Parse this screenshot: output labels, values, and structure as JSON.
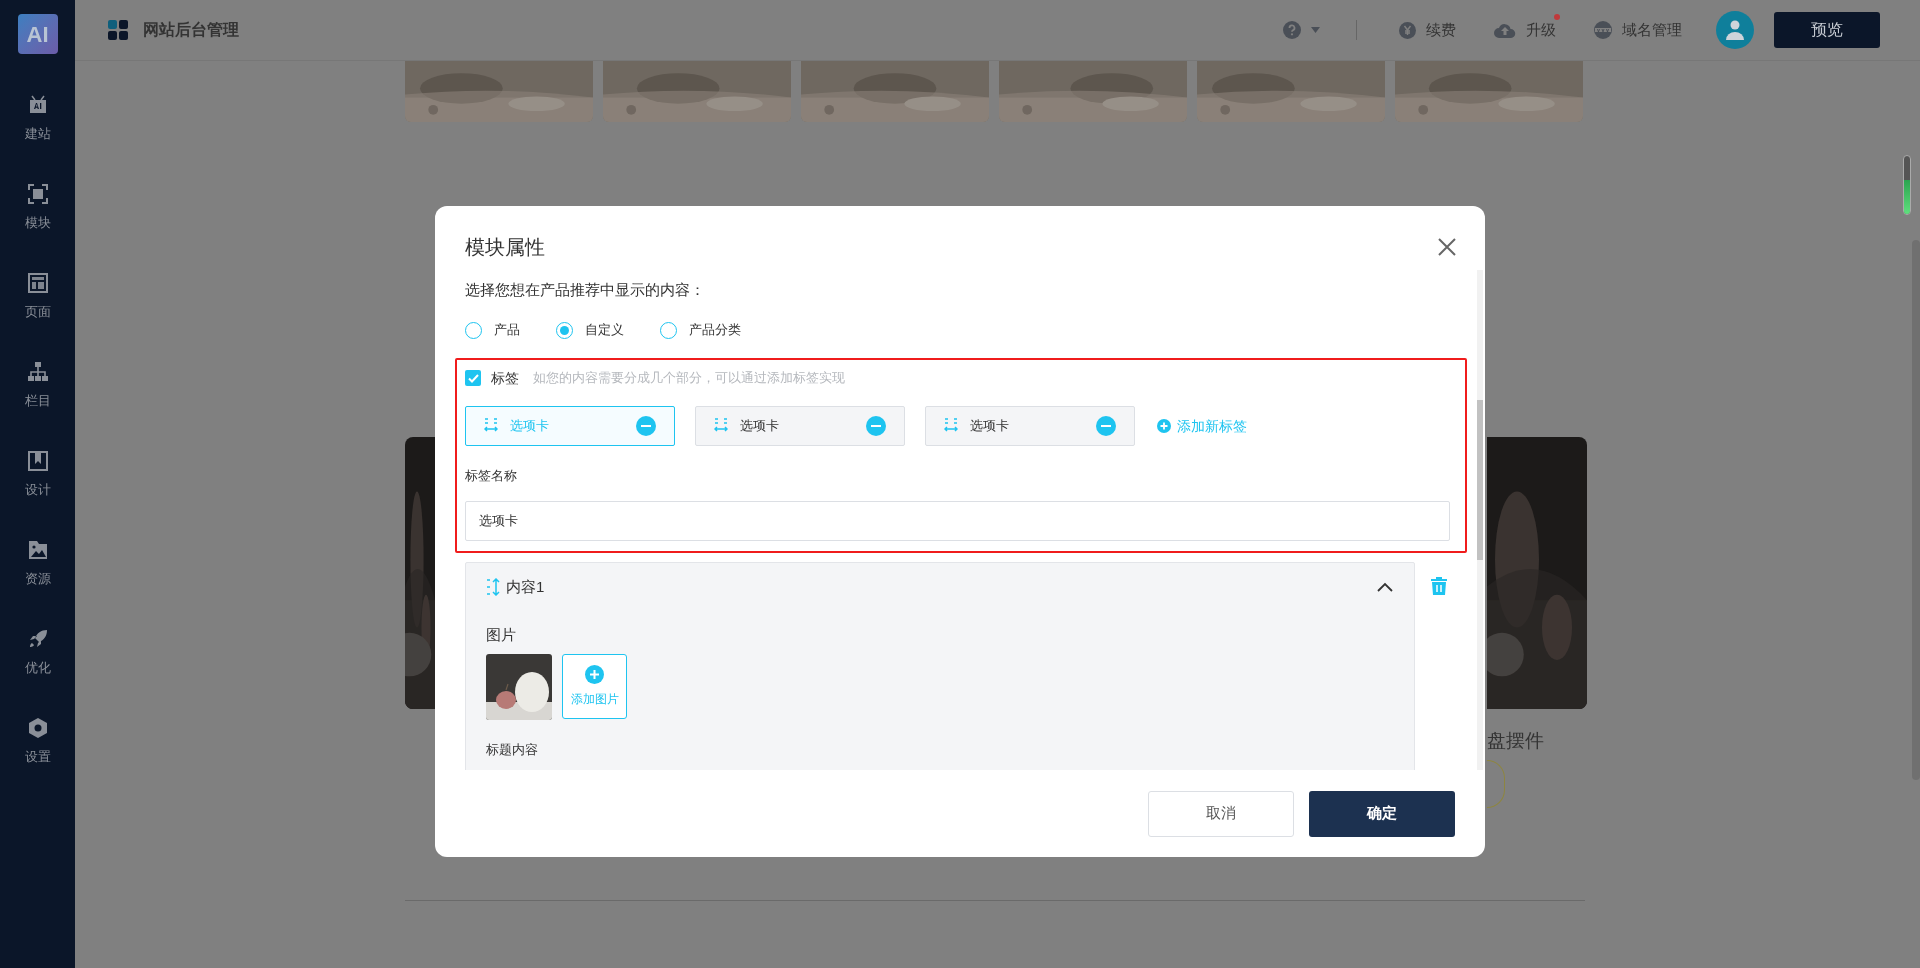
{
  "sidebar": {
    "logo": "AI",
    "items": [
      {
        "label": "建站"
      },
      {
        "label": "模块"
      },
      {
        "label": "页面"
      },
      {
        "label": "栏目"
      },
      {
        "label": "设计"
      },
      {
        "label": "资源"
      },
      {
        "label": "优化"
      },
      {
        "label": "设置"
      }
    ]
  },
  "topbar": {
    "title": "网站后台管理",
    "actions": [
      {
        "label": "续费",
        "notification": false
      },
      {
        "label": "升级",
        "notification": true
      },
      {
        "label": "域名管理",
        "notification": false
      }
    ],
    "preview_button": "预览"
  },
  "background": {
    "product_title": "盘摆件"
  },
  "dialog": {
    "title": "模块属性",
    "prompt": "选择您想在产品推荐中显示的内容：",
    "options": [
      {
        "label": "产品",
        "selected": false
      },
      {
        "label": "自定义",
        "selected": true
      },
      {
        "label": "产品分类",
        "selected": false
      }
    ],
    "tags_toggle": {
      "label": "标签",
      "checked": true,
      "hint": "如您的内容需要分成几个部分，可以通过添加标签实现"
    },
    "tabs": [
      {
        "label": "选项卡",
        "selected": true
      },
      {
        "label": "选项卡",
        "selected": false
      },
      {
        "label": "选项卡",
        "selected": false
      }
    ],
    "add_tag": "添加新标签",
    "tag_name": {
      "label": "标签名称",
      "value": "选项卡"
    },
    "content_items": [
      {
        "title": "内容1",
        "expanded": true,
        "image_label": "图片",
        "add_image": "添加图片",
        "title_label": "标题内容"
      }
    ],
    "buttons": {
      "cancel": "取消",
      "confirm": "确定"
    }
  }
}
